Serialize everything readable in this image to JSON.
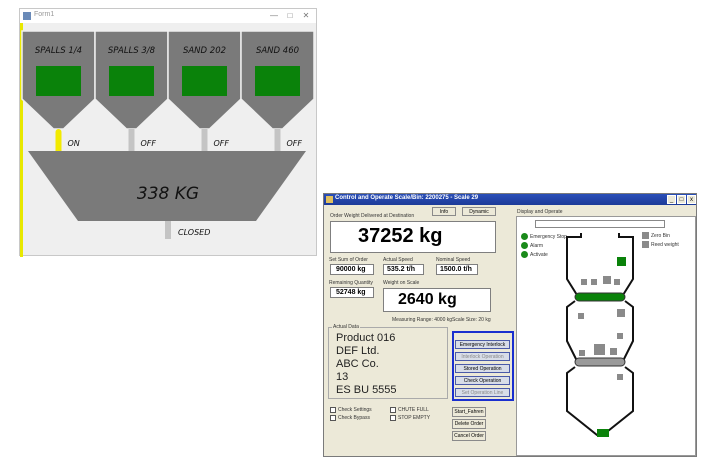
{
  "window1": {
    "title": "Form1",
    "controls": {
      "minimize": "—",
      "maximize": "□",
      "close": "✕"
    },
    "hoppers": [
      {
        "label": "SPALLS 1/4",
        "gate": "ON"
      },
      {
        "label": "SPALLS 3/8",
        "gate": "OFF"
      },
      {
        "label": "SAND 202",
        "gate": "OFF"
      },
      {
        "label": "SAND 460",
        "gate": "OFF"
      }
    ],
    "scale_weight": "338 KG",
    "discharge_state": "CLOSED",
    "colors": {
      "hopper": "#7a7a7a",
      "level": "#0a820a",
      "gate_on": "#f2ea00",
      "gate_off": "#c4c4c4"
    }
  },
  "window2": {
    "title": "Control and Operate Scale/Bin: 2200275 - Scale 29",
    "controls": {
      "minimize": "_",
      "maximize": "□",
      "close": "x"
    },
    "buttons": {
      "info": "Info",
      "dynamic": "Dynamic"
    },
    "order_weight_label": "Order Weight Delivered at Destination",
    "order_weight": "37252 kg",
    "set_sum_label": "Set Sum of Order",
    "set_sum": "90000 kg",
    "actual_speed_label": "Actual Speed",
    "actual_speed": "535.2 t/h",
    "nominal_speed_label": "Nominal Speed",
    "nominal_speed": "1500.0 t/h",
    "remaining_label": "Remaining Quantity",
    "remaining": "52748 kg",
    "weight_on_scale_label": "Weight on Scale",
    "weight_on_scale": "2640 kg",
    "measuring_range": "Measuring Range: 4000 kg",
    "scale_size": "Scale Size: 20 kg",
    "actual_data_label": "Actual Data",
    "actual_data": [
      "Product 016",
      "DEF Ltd.",
      "ABC Co.",
      "13",
      "ES BU 5555"
    ],
    "blue_buttons": [
      "Emergency Interlock",
      "Interlock Operation",
      "Stored Operation",
      "Check Operation",
      "Set Operation Line"
    ],
    "checkboxes": [
      {
        "label": "Check Settings"
      },
      {
        "label": "Check Bypass"
      },
      {
        "label": "CHUTE FULL"
      },
      {
        "label": "STOP EMPTY"
      }
    ],
    "bottom_buttons": [
      "Start_Fahren",
      "Delete Order",
      "Cancel Order"
    ],
    "display_label": "Display and Operate",
    "legend_left": [
      "Emergency Stop",
      "Alarm",
      "Activate"
    ],
    "legend_right": [
      "Zero Bin",
      "Reed weight"
    ],
    "colors": {
      "indicator": "#1a8a1a",
      "frame_blue": "#1a2fcf",
      "titlebar": "#1f3fa8"
    }
  }
}
